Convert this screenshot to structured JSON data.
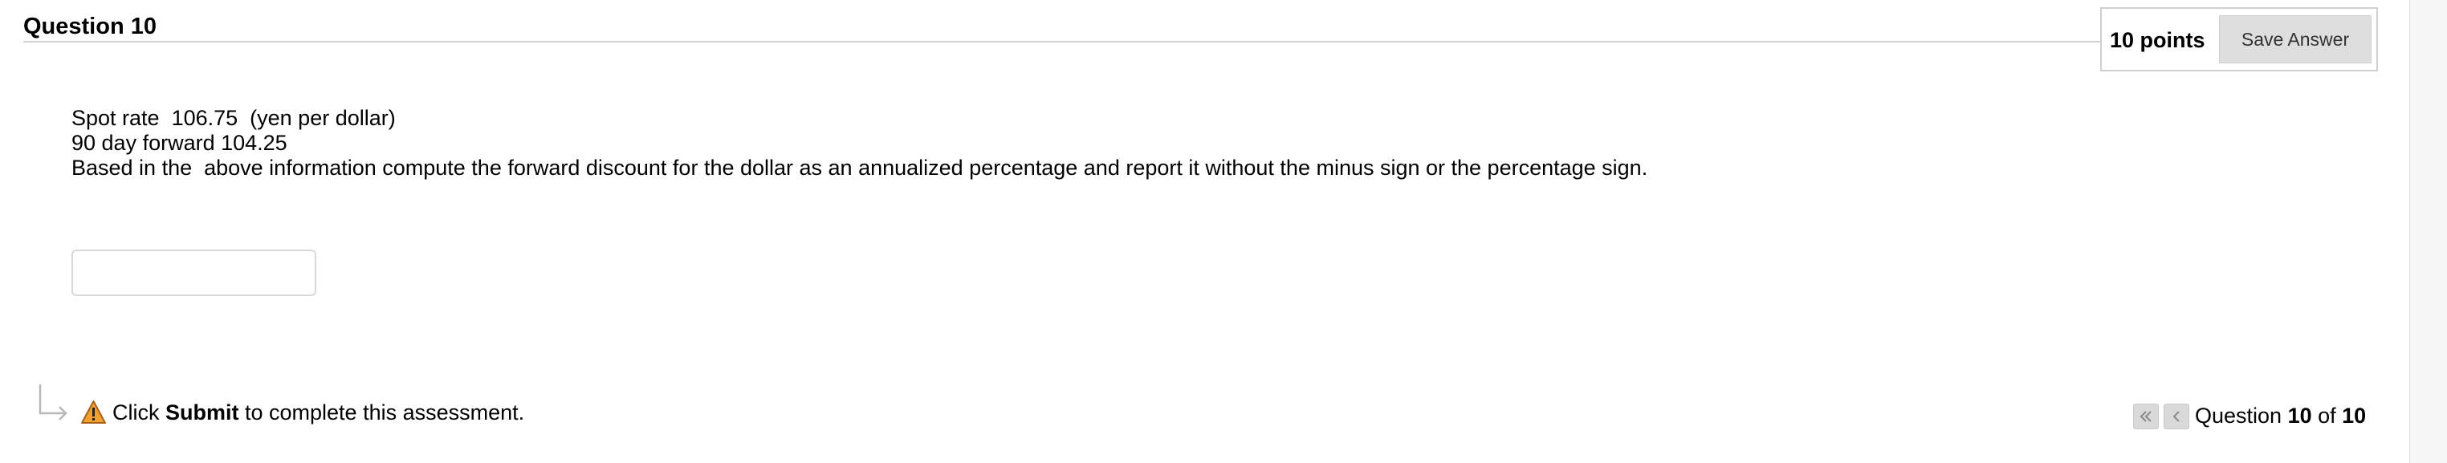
{
  "question": {
    "title": "Question 10",
    "points": "10 points",
    "save_label": "Save Answer",
    "lines": [
      "Spot rate  106.75  (yen per dollar)",
      "90 day forward 104.25",
      "Based in the  above information compute the forward discount for the dollar as an annualized percentage and report it without the minus sign or the percentage sign."
    ],
    "answer_value": "",
    "answer_placeholder": ""
  },
  "footer": {
    "arrow_icon": "return-arrow-icon",
    "warning_icon": "warning-icon",
    "note_prefix": "Click ",
    "note_bold": "Submit",
    "note_suffix": " to complete this assessment.",
    "nav": {
      "first_icon": "double-chevron-left-icon",
      "prev_icon": "chevron-left-icon",
      "label_prefix": "Question ",
      "current": "10",
      "label_mid": " of ",
      "total": "10"
    }
  },
  "colors": {
    "rule": "#d3d3d3",
    "button_bg": "#dedede",
    "warning_orange": "#f0a030",
    "gutter": "#f6f6f6"
  }
}
